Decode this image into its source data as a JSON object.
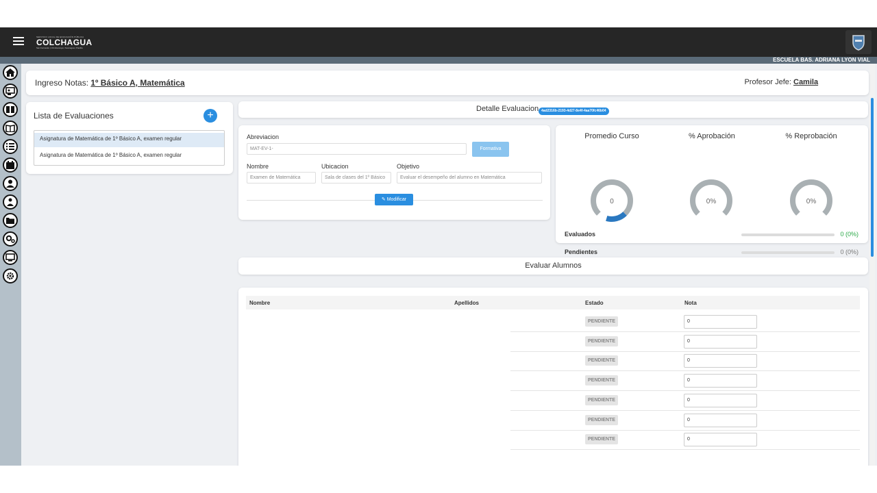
{
  "topbar": {
    "logo_small": "SERVICIO LOCAL DE EDUCACIÓN PÚBLICA",
    "logo_text": "COLCHAGUA",
    "logo_sub": "San Fernando | Chimbarongo | Nancagua | Placilla",
    "school_name": "ESCUELA BAS. ADRIANA LYON VIAL"
  },
  "sidebar": {
    "icons": [
      "home-icon",
      "presentation-icon",
      "book-icon",
      "book-open-icon",
      "list-icon",
      "calendar-icon",
      "user-icon",
      "users-icon",
      "folder-icon",
      "cogs-icon",
      "monitor-icon",
      "settings-icon"
    ]
  },
  "header": {
    "prefix": "Ingreso Notas: ",
    "course": "1º Básico A, Matemática",
    "profesor_label": "Profesor Jefe: ",
    "profesor_name": "Camila"
  },
  "lista": {
    "title": "Lista de Evaluaciones",
    "add": "+",
    "items": [
      "Asignatura de Matemática de 1º Básico A, examen regular",
      "Asignatura de Matemática de 1º Básico A, examen regular"
    ]
  },
  "detalle": {
    "title": "Detalle Evaluacion",
    "id_badge": "4ad2316b-2193-4d27-8e4f-4aa70fc46b04"
  },
  "form": {
    "abreviacion_label": "Abreviacion",
    "abreviacion_value": "MAT-EV-1-",
    "formativa_label": "Formativa",
    "nombre_label": "Nombre",
    "nombre_value": "Examen de Matemática",
    "ubicacion_label": "Ubicacion",
    "ubicacion_value": "Sala de clases del 1º Básico",
    "objetivo_label": "Objetivo",
    "objetivo_value": "Evaluar el desempeño del alumno en Matemática",
    "modificar_label": "Modificar"
  },
  "stats": {
    "promedio_title": "Promedio Curso",
    "promedio_value": "0",
    "aprobacion_title": "% Aprobación",
    "aprobacion_value": "0%",
    "reprobacion_title": "% Reprobación",
    "reprobacion_value": "0%",
    "evaluados_label": "Evaluados",
    "evaluados_value": "0 (0%)",
    "pendientes_label": "Pendientes",
    "pendientes_value": "0 (0%)",
    "colors": {
      "accent": "#2a8ee0",
      "gauge": "#a9b0b3",
      "success": "#28a745"
    }
  },
  "evaluar": {
    "title": "Evaluar Alumnos",
    "columns": [
      "Nombre",
      "Apellidos",
      "Estado",
      "Nota"
    ],
    "rows": [
      {
        "estado": "PENDIENTE",
        "nota": "0"
      },
      {
        "estado": "PENDIENTE",
        "nota": "0"
      },
      {
        "estado": "PENDIENTE",
        "nota": "0"
      },
      {
        "estado": "PENDIENTE",
        "nota": "0"
      },
      {
        "estado": "PENDIENTE",
        "nota": "0"
      },
      {
        "estado": "PENDIENTE",
        "nota": "0"
      },
      {
        "estado": "PENDIENTE",
        "nota": "0"
      }
    ]
  }
}
